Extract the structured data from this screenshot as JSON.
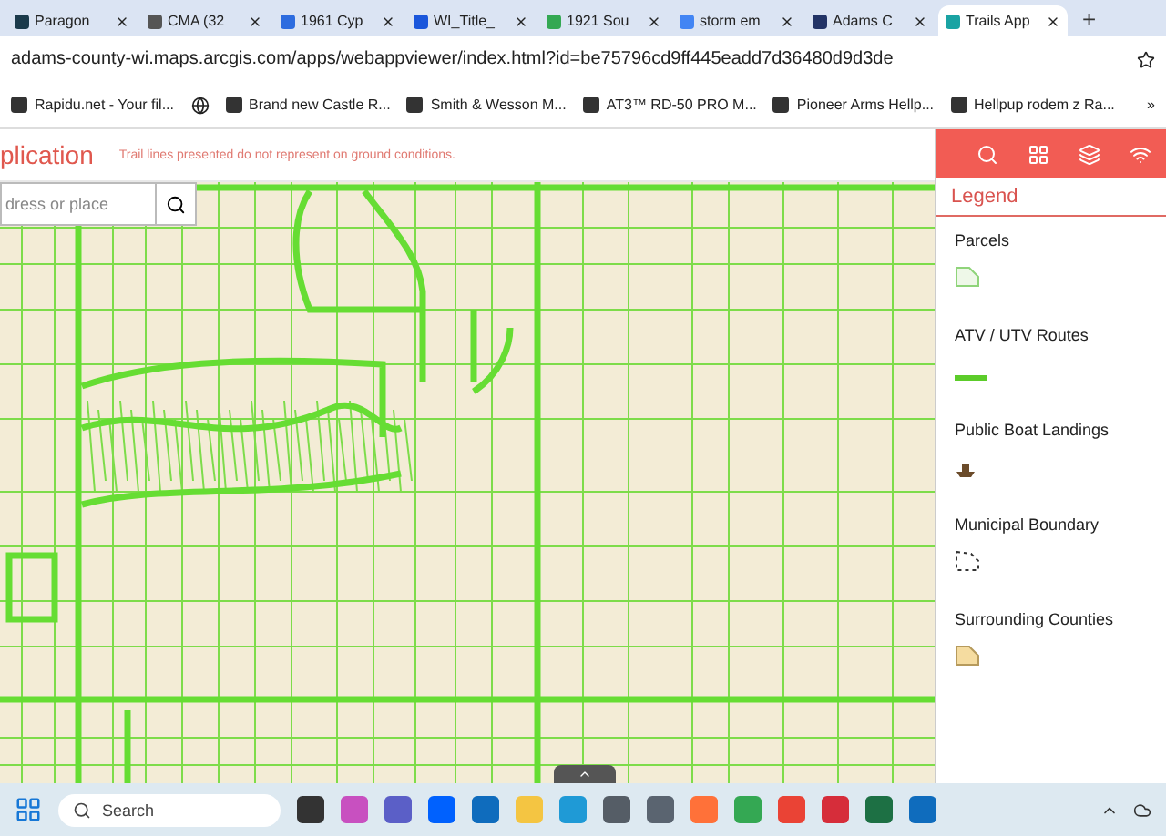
{
  "browser_tabs": [
    {
      "title": "Paragon",
      "selected": false
    },
    {
      "title": "CMA (32",
      "selected": false
    },
    {
      "title": "1961 Cyp",
      "selected": false
    },
    {
      "title": "WI_Title_",
      "selected": false
    },
    {
      "title": "1921 Sou",
      "selected": false
    },
    {
      "title": "storm em",
      "selected": false
    },
    {
      "title": "Adams C",
      "selected": false
    },
    {
      "title": "Trails App",
      "selected": true
    }
  ],
  "new_tab": "+",
  "address": "adams-county-wi.maps.arcgis.com/apps/webappviewer/index.html?id=be75796cd9ff445eadd7d36480d9d3de",
  "bookmarks": [
    {
      "kind": "site",
      "title": "Rapidu.net - Your fil..."
    },
    {
      "kind": "globe"
    },
    {
      "kind": "site",
      "title": "Brand new Castle R..."
    },
    {
      "kind": "site",
      "title": "Smith & Wesson M..."
    },
    {
      "kind": "site",
      "title": "AT3™ RD-50 PRO M..."
    },
    {
      "kind": "site",
      "title": "Pioneer Arms Hellp..."
    },
    {
      "kind": "site",
      "title": "Hellpup rodem z Ra..."
    }
  ],
  "bookmarks_more": "»",
  "app": {
    "title": "plication",
    "notice": "Trail lines presented do not represent on ground conditions."
  },
  "search": {
    "placeholder": "dress or place"
  },
  "legend": {
    "title": "Legend",
    "items": [
      {
        "label": "Parcels",
        "kind": "parcel"
      },
      {
        "label": "ATV / UTV Routes",
        "kind": "route"
      },
      {
        "label": "Public Boat Landings",
        "kind": "boat"
      },
      {
        "label": "Municipal Boundary",
        "kind": "boundary"
      },
      {
        "label": "Surrounding Counties",
        "kind": "county"
      }
    ]
  },
  "taskbar": {
    "search_placeholder": "Search",
    "apps": [
      {
        "color": "#333333"
      },
      {
        "color": "#c850c0"
      },
      {
        "color": "#5b5fc7"
      },
      {
        "color": "#0061fe"
      },
      {
        "color": "#0f6cbd"
      },
      {
        "color": "#f4c542"
      },
      {
        "color": "#1f9ad6"
      },
      {
        "color": "#555d66"
      },
      {
        "color": "#5a6470"
      },
      {
        "color": "#ff7139"
      },
      {
        "color": "#34a853"
      },
      {
        "color": "#ea4335"
      },
      {
        "color": "#d62d3a"
      },
      {
        "color": "#1d7044"
      },
      {
        "color": "#0f6cbd"
      }
    ]
  }
}
